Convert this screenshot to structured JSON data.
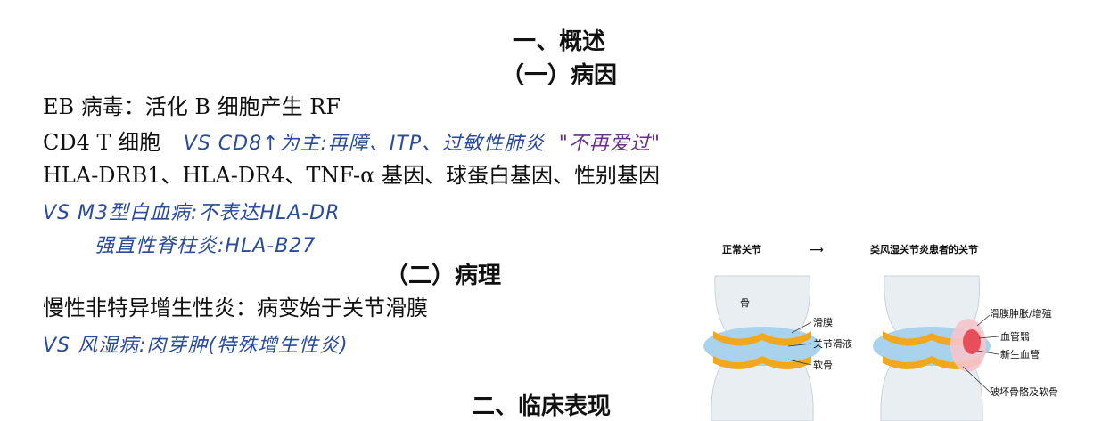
{
  "sections": {
    "overview_heading": "一、概述",
    "etiology_heading": "（一）病因",
    "pathology_heading": "（二）病理",
    "clinical_heading": "二、临床表现"
  },
  "etiology": {
    "line1": "EB 病毒：活化 B 细胞产生 RF",
    "line2_print": "CD4 T 细胞",
    "line2_note": "VS  CD8↑为主:再障、ITP、过敏性肺炎",
    "line2_quote": "\"不再爱过\"",
    "line3": "HLA-DRB1、HLA-DR4、TNF-α 基因、球蛋白基因、性别基因",
    "note1": "VS  M3型白血病:不表达HLA-DR",
    "note2": "强直性脊柱炎:HLA-B27"
  },
  "pathology": {
    "line1": "慢性非特异增生性炎：病变始于关节滑膜",
    "note1": "VS  风湿病:肉芽肿(特殊增生性炎)"
  },
  "diagram": {
    "title_normal": "正常关节",
    "arrow": "⟶",
    "title_ra": "类风湿关节炎患者的关节",
    "label_bone": "骨",
    "label_synovium": "滑膜",
    "label_fluid": "关节滑液",
    "label_cartilage": "软骨",
    "label_swelling": "滑膜肿胀/增殖",
    "label_pannus": "血管翳",
    "label_vessels": "新生血管",
    "label_damage": "破坏骨骼及软骨"
  },
  "colors": {
    "note_blue": "#2a4b9a",
    "note_purple": "#6b2d8a",
    "cartilage": "#f2a81d",
    "fluid": "#a9d3ec",
    "bone": "#e9eef2",
    "inflammation": "#e63946"
  }
}
